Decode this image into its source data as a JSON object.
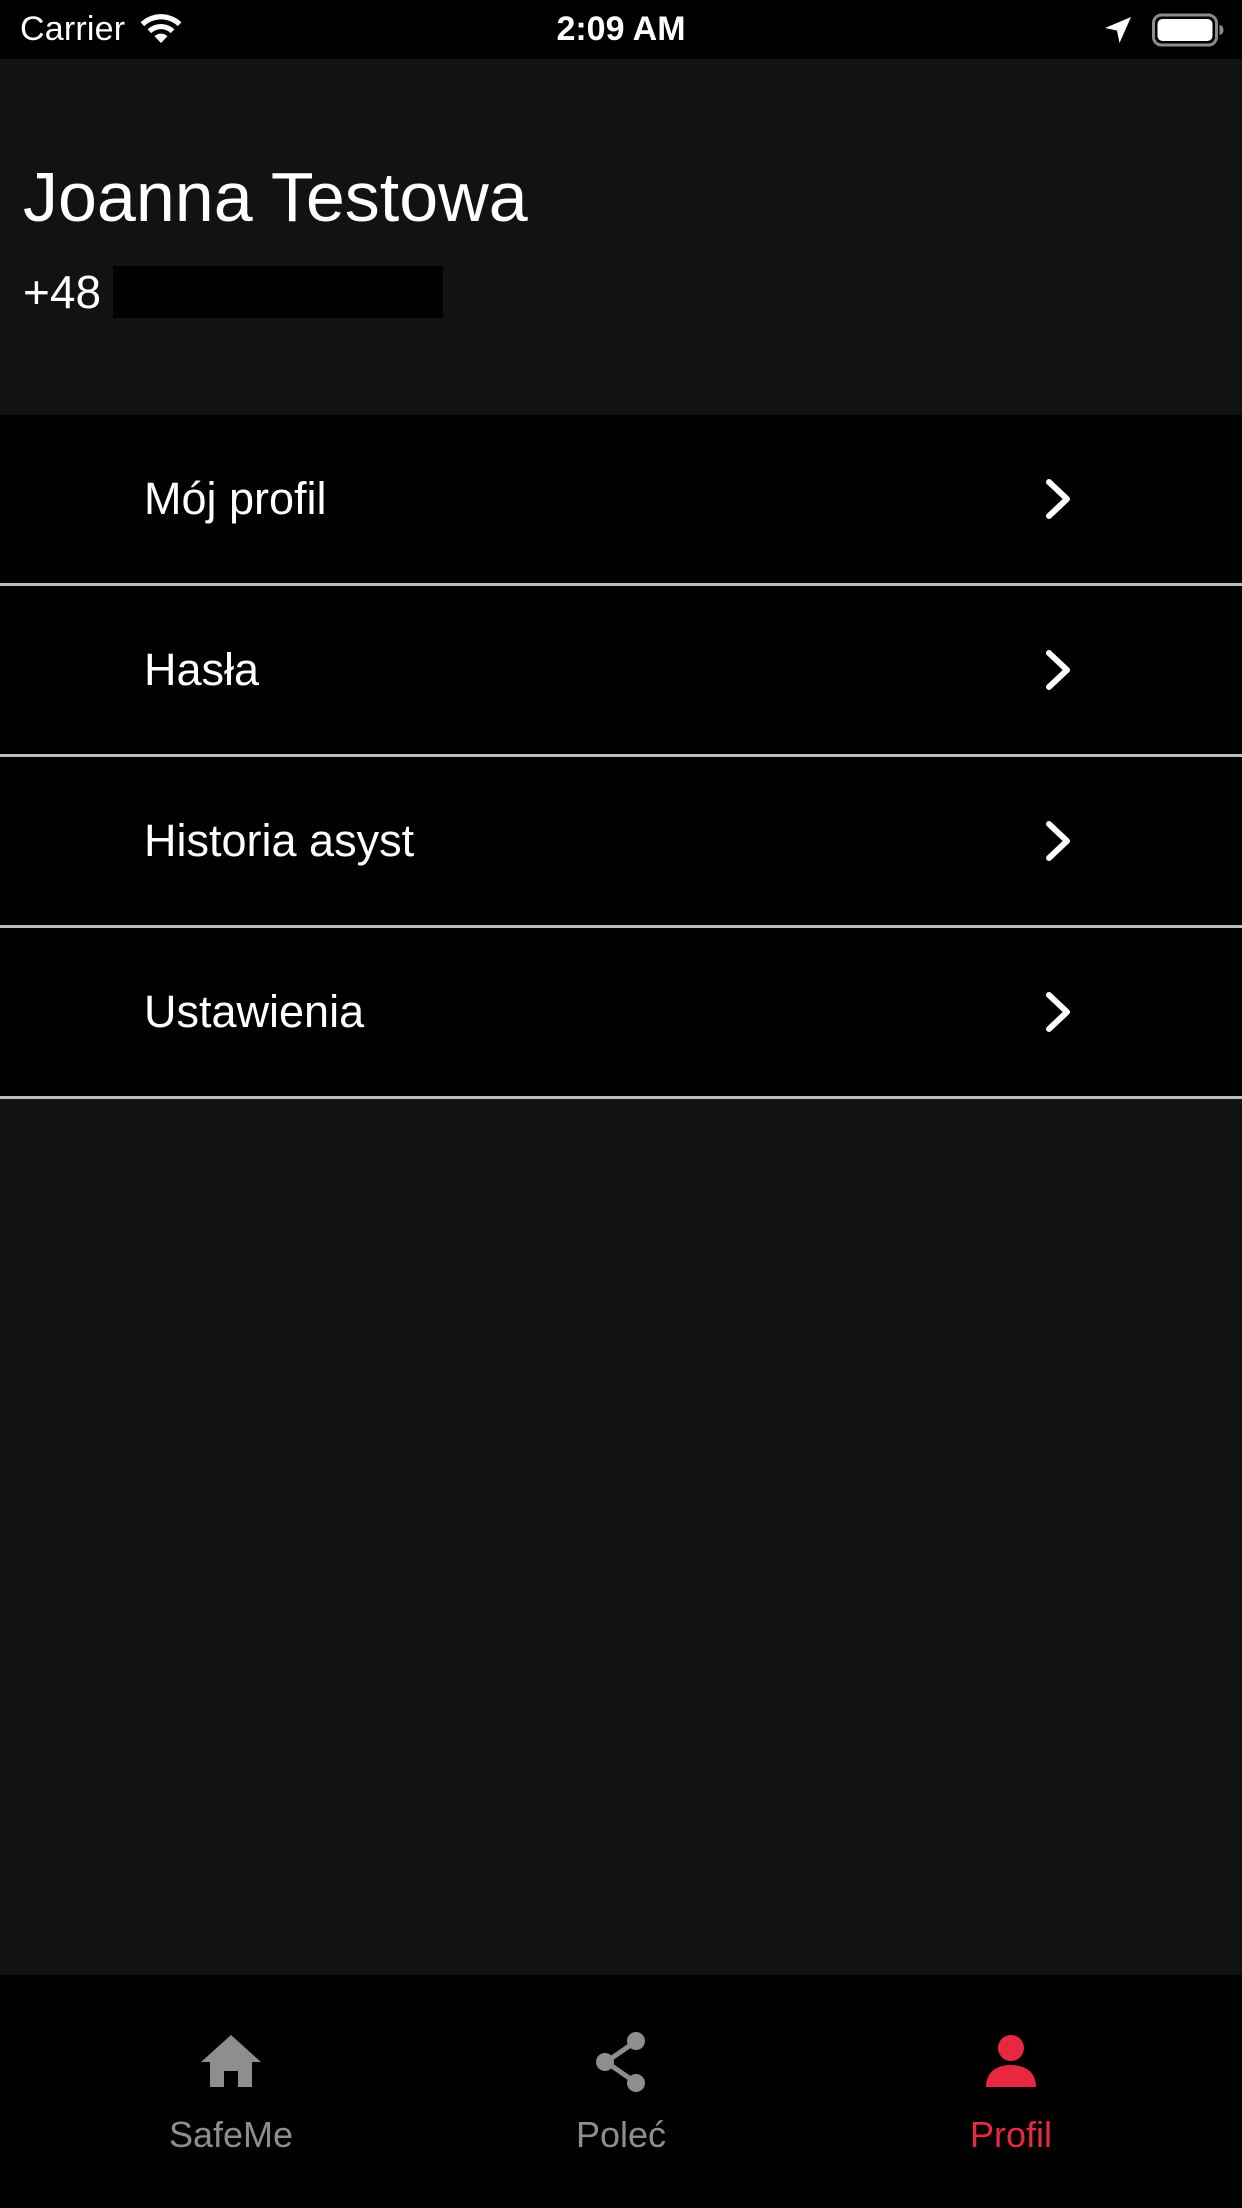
{
  "status_bar": {
    "carrier": "Carrier",
    "time": "2:09 AM",
    "icons": [
      "wifi-icon",
      "location-arrow-icon",
      "battery-icon"
    ]
  },
  "header": {
    "name": "Joanna Testowa",
    "phone_prefix": "+48"
  },
  "menu": {
    "items": [
      {
        "label": "Mój profil",
        "icon": "chevron-right-icon"
      },
      {
        "label": "Hasła",
        "icon": "chevron-right-icon"
      },
      {
        "label": "Historia asyst",
        "icon": "chevron-right-icon"
      },
      {
        "label": "Ustawienia",
        "icon": "chevron-right-icon"
      }
    ]
  },
  "tab_bar": {
    "tabs": [
      {
        "label": "SafeMe",
        "icon": "home-icon",
        "active": false
      },
      {
        "label": "Poleć",
        "icon": "share-icon",
        "active": false
      },
      {
        "label": "Profil",
        "icon": "person-icon",
        "active": true
      }
    ]
  },
  "colors": {
    "background": "#121212",
    "surface": "#000000",
    "divider": "#bdbdbd",
    "text": "#ffffff",
    "tab_inactive": "#8e8e8e",
    "tab_active": "#e8283e"
  }
}
